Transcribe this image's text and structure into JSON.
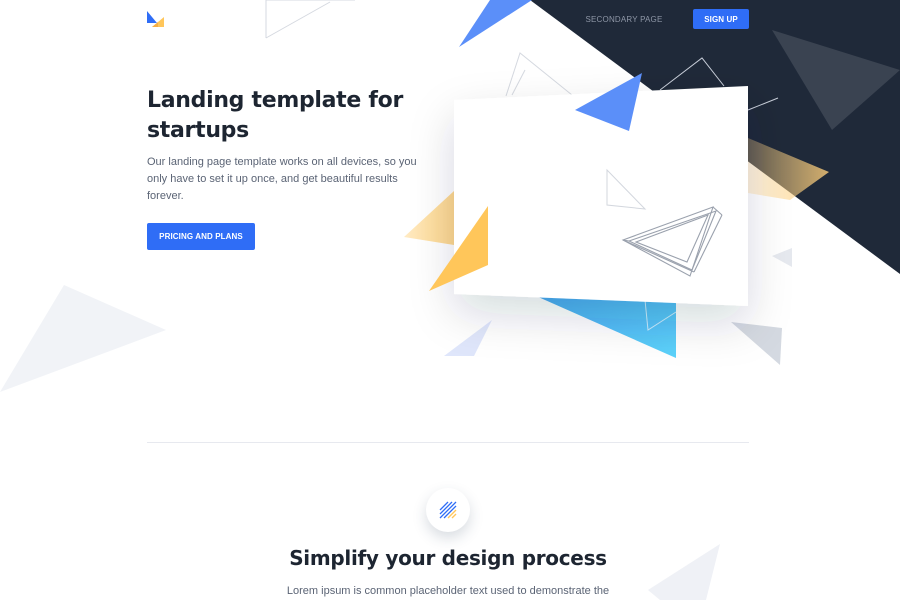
{
  "header": {
    "logo": "brand-logo",
    "nav_link": "SECONDARY PAGE",
    "signup_label": "SIGN UP"
  },
  "hero": {
    "title": "Landing template for startups",
    "description": "Our landing page template works on all devices, so you only have to set it up once, and get beautiful results forever.",
    "cta_label": "PRICING AND PLANS"
  },
  "features": {
    "icon": "striped-square-icon",
    "title": "Simplify your design process",
    "text": "Lorem ipsum is common placeholder text used to demonstrate the"
  },
  "colors": {
    "primary": "#2f6df6",
    "dark": "#1d2531",
    "yellow": "#ffc65a",
    "cyan": "#4ec0f5",
    "light_gray": "#f2f4f8"
  }
}
